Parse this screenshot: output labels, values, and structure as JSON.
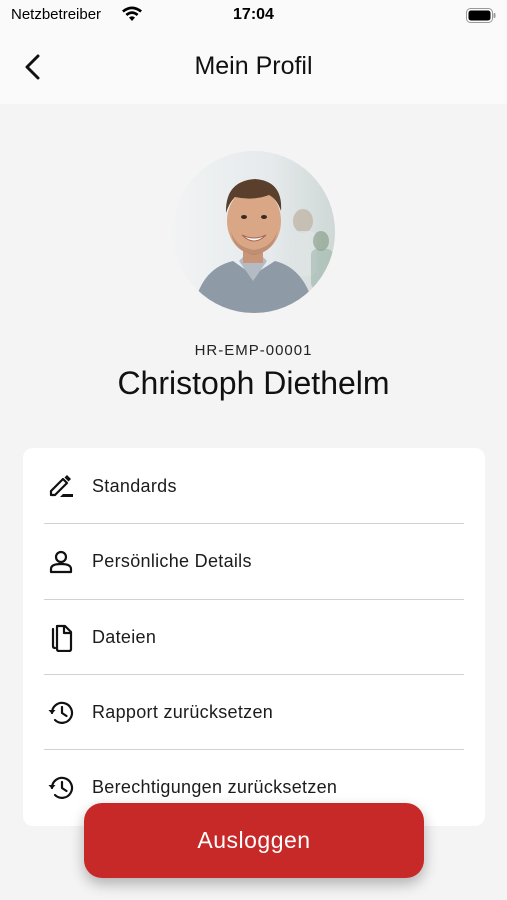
{
  "status_bar": {
    "carrier": "Netzbetreiber",
    "time": "17:04"
  },
  "nav": {
    "title": "Mein Profil",
    "back_icon": "chevron-left-icon"
  },
  "profile": {
    "employee_id": "HR-EMP-00001",
    "name": "Christoph Diethelm"
  },
  "menu": {
    "items": [
      {
        "label": "Standards",
        "icon": "edit-pen-icon"
      },
      {
        "label": "Persönliche Details",
        "icon": "person-icon"
      },
      {
        "label": "Dateien",
        "icon": "files-icon"
      },
      {
        "label": "Rapport zurücksetzen",
        "icon": "history-icon"
      },
      {
        "label": "Berechtigungen zurücksetzen",
        "icon": "history-icon"
      }
    ]
  },
  "logout": {
    "label": "Ausloggen"
  },
  "colors": {
    "accent": "#c72828",
    "background": "#f4f4f4",
    "card": "#ffffff",
    "divider": "#d2d2d2"
  }
}
